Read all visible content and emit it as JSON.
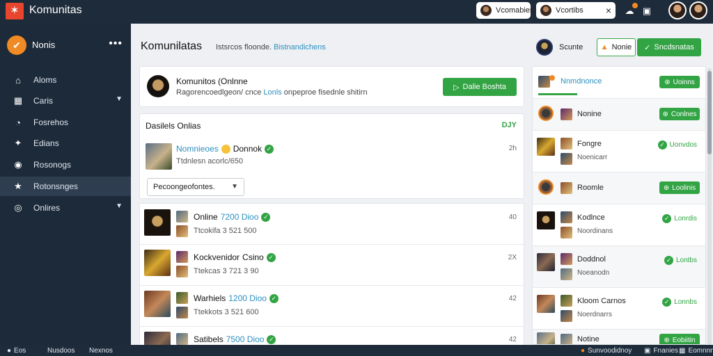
{
  "topbar": {
    "app_title": "Komunitas",
    "search_pill_1": "Vcomabies",
    "search_pill_2": "Vcortibs",
    "close_symbol": "×"
  },
  "sidebar": {
    "header_label": "Nonis",
    "more_symbol": "•••",
    "items": [
      {
        "label": "Aloms",
        "icon": "home-icon"
      },
      {
        "label": "Caris",
        "icon": "grid-icon"
      },
      {
        "label": "Fosrehos",
        "icon": "chat-icon"
      },
      {
        "label": "Edians",
        "icon": "twitter-icon"
      },
      {
        "label": "Rosonogs",
        "icon": "message-icon"
      },
      {
        "label": "Rotonsnges",
        "icon": "star-icon"
      },
      {
        "label": "Onlires",
        "icon": "globe-icon"
      }
    ]
  },
  "header": {
    "title": "Komunilatas",
    "subtitle_plain": "Istsrcos floonde.",
    "subtitle_link": "Bistnandichens",
    "user_name": "Scunte",
    "btn_outline": "Nonie",
    "btn_primary": "Sncdsnatas"
  },
  "profile": {
    "name": "Komunitos (Onlnne",
    "desc_plain": "Ragorencoedlgeon/ cnce",
    "desc_link": "Lonls",
    "desc_tail": "onpeproe fisednle shitirn",
    "button": "Dalie Boshta"
  },
  "section": {
    "title": "Dasilels Onlias",
    "tag": "DJY",
    "first_name": "Nomnieoes",
    "first_suffix": "Donnok",
    "first_sub": "Ttdnlesn acorlc/650",
    "first_time": "2h",
    "dropdown": "Pecoongeofontes."
  },
  "rows": [
    {
      "name": "Online",
      "hl": "7200 Dioo",
      "sub": "Ttcokifa 3 521 500",
      "time": "40"
    },
    {
      "name": "Kockvenidor",
      "hl": "Csino",
      "sub": "Ttekcas 3 721 3 90",
      "time": "2X"
    },
    {
      "name": "Warhiels",
      "hl": "1200 Dioo",
      "sub": "Ttekkots 3 521 600",
      "time": "42"
    },
    {
      "name": "Satibels",
      "hl": "7500 Dioo",
      "sub": "",
      "time": "42"
    }
  ],
  "right_panel": [
    {
      "name": "Nnmdnonce",
      "sub": "",
      "action": "Uoinns",
      "type": "button",
      "highlight": true
    },
    {
      "name": "Nonine",
      "sub": "",
      "action": "Conlnes",
      "type": "button",
      "highlight": false
    },
    {
      "name": "Fongre",
      "sub": "Noenicarr",
      "action": "Uonvdos",
      "type": "status",
      "highlight": false
    },
    {
      "name": "Roomle",
      "sub": "",
      "action": "Loolinis",
      "type": "button",
      "highlight": false
    },
    {
      "name": "Kodlnce",
      "sub": "Noordinans",
      "action": "Lonrdis",
      "type": "status",
      "highlight": false
    },
    {
      "name": "Doddnol",
      "sub": "Noeanodn",
      "action": "Lontbs",
      "type": "status",
      "highlight": false
    },
    {
      "name": "Kloom Carnos",
      "sub": "Noerdnarrs",
      "action": "Lonnbs",
      "type": "status",
      "highlight": false
    },
    {
      "name": "Notine",
      "sub": "",
      "action": "Eobiitin",
      "type": "button",
      "highlight": false
    }
  ],
  "bottombar": {
    "item1": "Eos",
    "item2": "Nusdoos",
    "item3": "Nexnos",
    "item4": "Sunvoodidnoy",
    "item5": "Fnanies",
    "item6": "Eomnnnm"
  },
  "colors": {
    "accent_green": "#32a444",
    "brand_orange": "#f08a24",
    "link_blue": "#2a8fbf",
    "sidebar_bg": "#1d2a39"
  }
}
